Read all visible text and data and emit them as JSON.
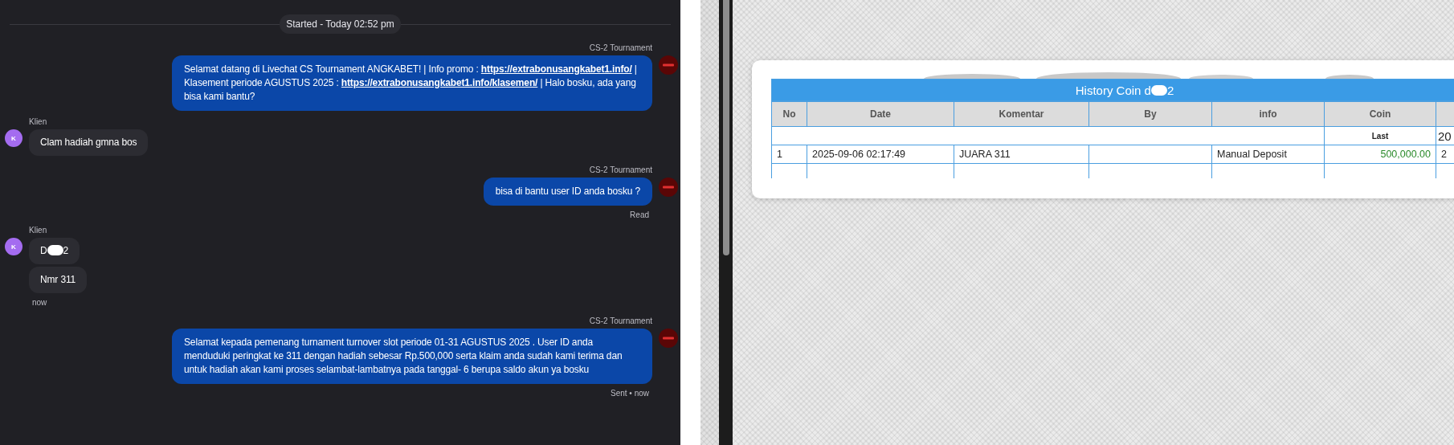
{
  "chat": {
    "session_banner": "Started - Today 02:52 pm",
    "groups": [
      {
        "kind": "agent",
        "sender_name": "CS-2 Tournament",
        "bubbles": [
          {
            "segments": [
              {
                "kind": "text",
                "text": "Selamat datang di Livechat CS Tournament ANGKABET! | Info promo : "
              },
              {
                "kind": "link",
                "text": "https://extrabonusangkabet1.info/"
              },
              {
                "kind": "text",
                "text": " | Klasement periode AGUSTUS 2025 : "
              },
              {
                "kind": "link",
                "text": "https://extrabonusangkabet1.info/klasemen/"
              },
              {
                "kind": "text",
                "text": " | Halo bosku, ada yang bisa kami bantu?"
              }
            ]
          }
        ]
      },
      {
        "kind": "client",
        "sender_name": "Klien",
        "avatar": "K",
        "bubbles": [
          {
            "segments": [
              {
                "kind": "text",
                "text": "Clam hadiah gmna bos"
              }
            ]
          }
        ]
      },
      {
        "kind": "agent",
        "sender_name": "CS-2 Tournament",
        "status": "Read",
        "bubbles": [
          {
            "segments": [
              {
                "kind": "text",
                "text": "bisa di bantu user ID anda bosku ?"
              }
            ]
          }
        ]
      },
      {
        "kind": "client",
        "sender_name": "Klien",
        "avatar": "K",
        "status": "now",
        "bubbles": [
          {
            "segments": [
              {
                "kind": "text",
                "text": "D"
              },
              {
                "kind": "redaction"
              },
              {
                "kind": "text",
                "text": "2"
              }
            ]
          },
          {
            "segments": [
              {
                "kind": "text",
                "text": "Nmr 311"
              }
            ]
          }
        ]
      },
      {
        "kind": "agent",
        "sender_name": "CS-2 Tournament",
        "status": "Sent • now",
        "bubbles": [
          {
            "segments": [
              {
                "kind": "text",
                "text": "Selamat kepada pemenang turnament turnover slot periode 01-31 AGUSTUS 2025 . User ID anda menduduki peringkat ke 311 dengan hadiah sebesar Rp.500,000 serta klaim anda sudah kami terima dan untuk hadiah akan kami proses selambat-lambatnya pada tanggal- 6 berupa saldo akun ya bosku"
              }
            ]
          }
        ]
      }
    ]
  },
  "history": {
    "title_start": "History Coin d",
    "title_end": "2",
    "columns": [
      "No",
      "Date",
      "Komentar",
      "By",
      "info",
      "Coin"
    ],
    "summary": {
      "label": "Last",
      "column_7": "20"
    },
    "rows": [
      {
        "no": "1",
        "date": "2025-09-06 02:17:49",
        "komentar": "JUARA 311",
        "info": "Manual Deposit",
        "coin": "500,000.00",
        "column_7": "2"
      }
    ]
  }
}
